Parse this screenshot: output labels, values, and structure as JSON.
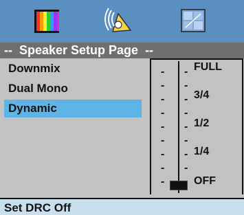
{
  "header": {
    "tabs": [
      {
        "icon": "video-setup-icon",
        "active": false
      },
      {
        "icon": "speaker-setup-icon",
        "active": true
      },
      {
        "icon": "preference-setup-icon",
        "active": false
      }
    ],
    "title": "--  Speaker Setup Page  --"
  },
  "menu": {
    "items": [
      {
        "label": "Downmix",
        "selected": false
      },
      {
        "label": "Dual Mono",
        "selected": false
      },
      {
        "label": "Dynamic",
        "selected": true
      }
    ]
  },
  "drc_slider": {
    "levels": [
      "FULL",
      "3/4",
      "1/2",
      "1/4",
      "OFF"
    ],
    "current": "OFF",
    "value": 0
  },
  "status": {
    "text": "Set DRC Off"
  },
  "colors": {
    "accent": "#5b8fc2",
    "selection": "#5eb4e6",
    "title_bar": "#6f6f6f",
    "background": "#c2c2c2",
    "status_bar": "#c8dfee"
  }
}
